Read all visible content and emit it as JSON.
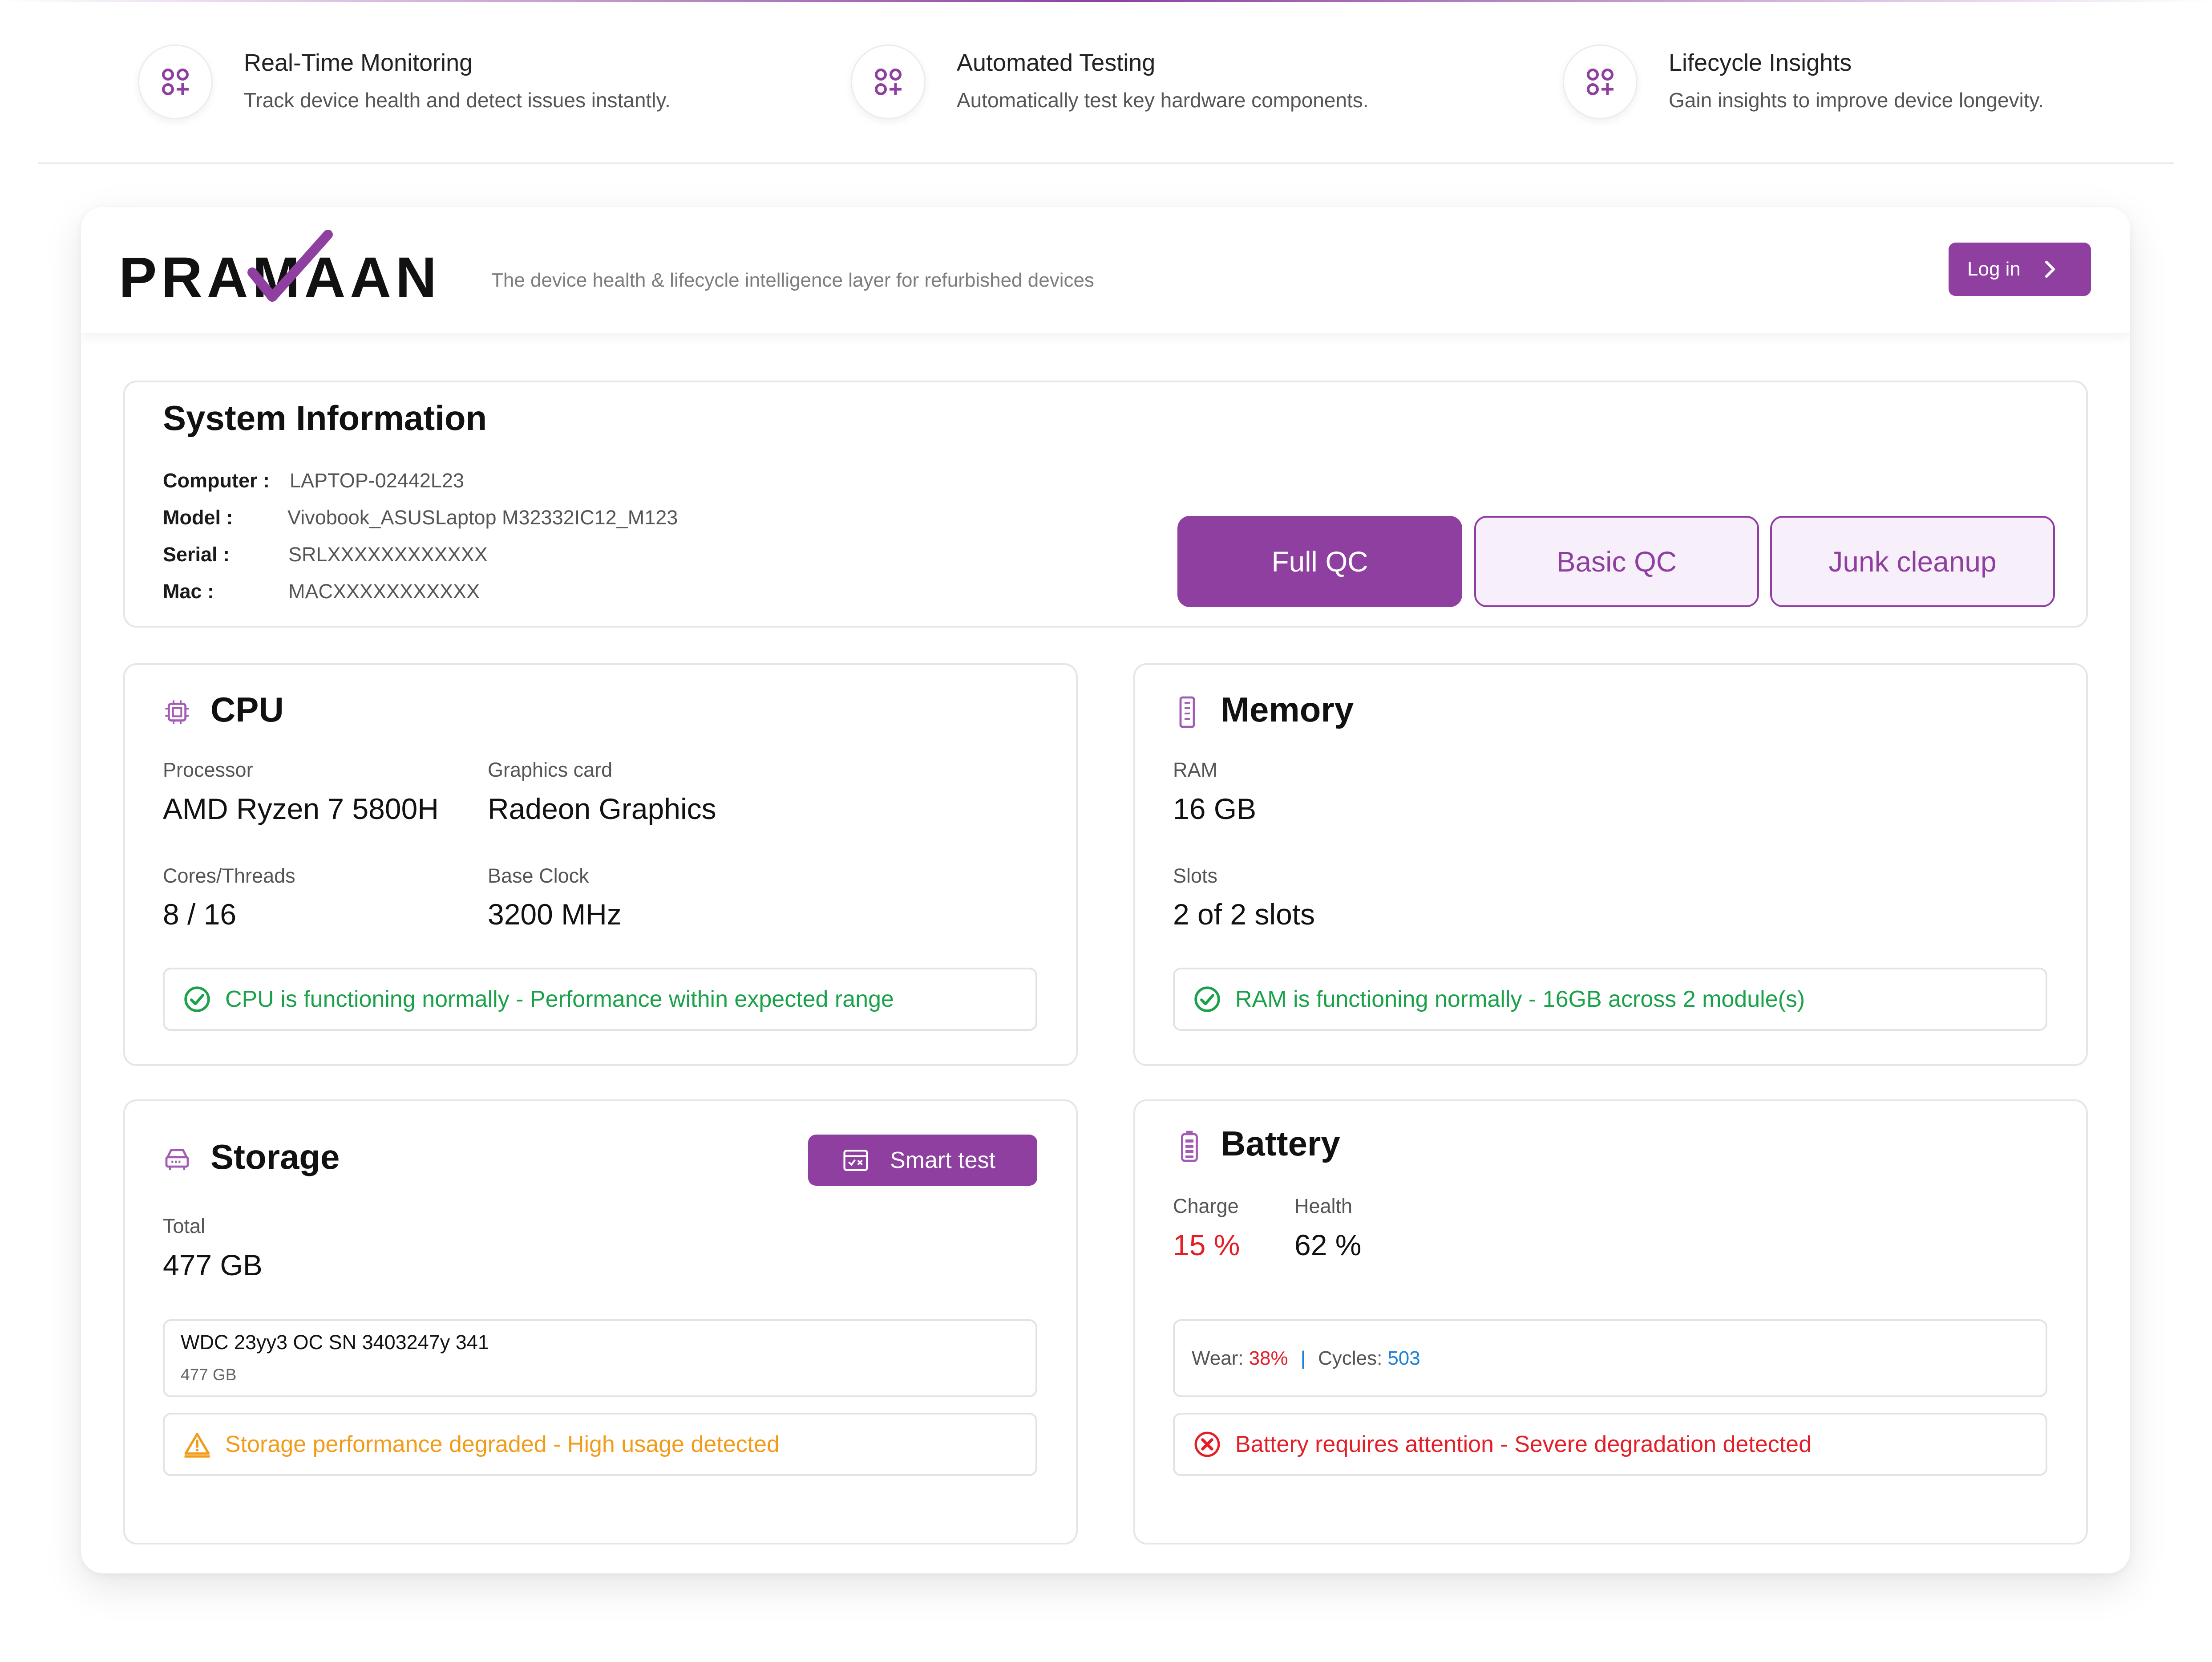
{
  "features": [
    {
      "icon": "apps-add-icon",
      "title": "Real-Time Monitoring",
      "desc": "Track device health and detect issues instantly."
    },
    {
      "icon": "apps-add-icon",
      "title": "Automated Testing",
      "desc": "Automatically test key hardware components."
    },
    {
      "icon": "apps-add-icon",
      "title": "Lifecycle Insights",
      "desc": "Gain insights to improve device longevity."
    }
  ],
  "header": {
    "logo_text": "PRAMAAN",
    "tagline": "The device health & lifecycle intelligence layer for refurbished devices",
    "login_label": "Log in"
  },
  "system": {
    "title": "System Information",
    "rows": [
      {
        "key": "Computer :",
        "value": "LAPTOP-02442L23"
      },
      {
        "key": "Model :",
        "value": "Vivobook_ASUSLaptop M32332IC12_M123"
      },
      {
        "key": "Serial :",
        "value": "SRLXXXXXXXXXXXX"
      },
      {
        "key": "Mac :",
        "value": "MACXXXXXXXXXXX"
      }
    ],
    "actions": {
      "full_qc": "Full QC",
      "basic_qc": "Basic QC",
      "junk_cleanup": "Junk cleanup"
    }
  },
  "cpu": {
    "title": "CPU",
    "processor_label": "Processor",
    "processor": "AMD Ryzen 7 5800H",
    "graphics_label": "Graphics card",
    "graphics": "Radeon Graphics",
    "cores_label": "Cores/Threads",
    "cores": "8 / 16",
    "clock_label": "Base Clock",
    "clock": "3200 MHz",
    "status": "CPU is functioning normally - Performance within expected range"
  },
  "memory": {
    "title": "Memory",
    "ram_label": "RAM",
    "ram": "16 GB",
    "slots_label": "Slots",
    "slots": "2 of 2 slots",
    "status": "RAM is functioning normally - 16GB across 2 module(s)"
  },
  "storage": {
    "title": "Storage",
    "smart_test_label": "Smart test",
    "total_label": "Total",
    "total": "477 GB",
    "drive_name": "WDC 23yy3 OC SN 3403247y 341",
    "drive_size": "477 GB",
    "status": "Storage performance degraded - High usage detected"
  },
  "battery": {
    "title": "Battery",
    "charge_label": "Charge",
    "charge": "15 %",
    "health_label": "Health",
    "health": "62 %",
    "wear_label": "Wear:",
    "wear": "38%",
    "separator": "|",
    "cycles_label": "Cycles:",
    "cycles": "503",
    "status": "Battery requires attention - Severe degradation detected"
  },
  "colors": {
    "brand": "#8e3fa0",
    "ok": "#1aa14a",
    "warn": "#f29b18",
    "error": "#e41e26",
    "info": "#1f7fd6"
  }
}
